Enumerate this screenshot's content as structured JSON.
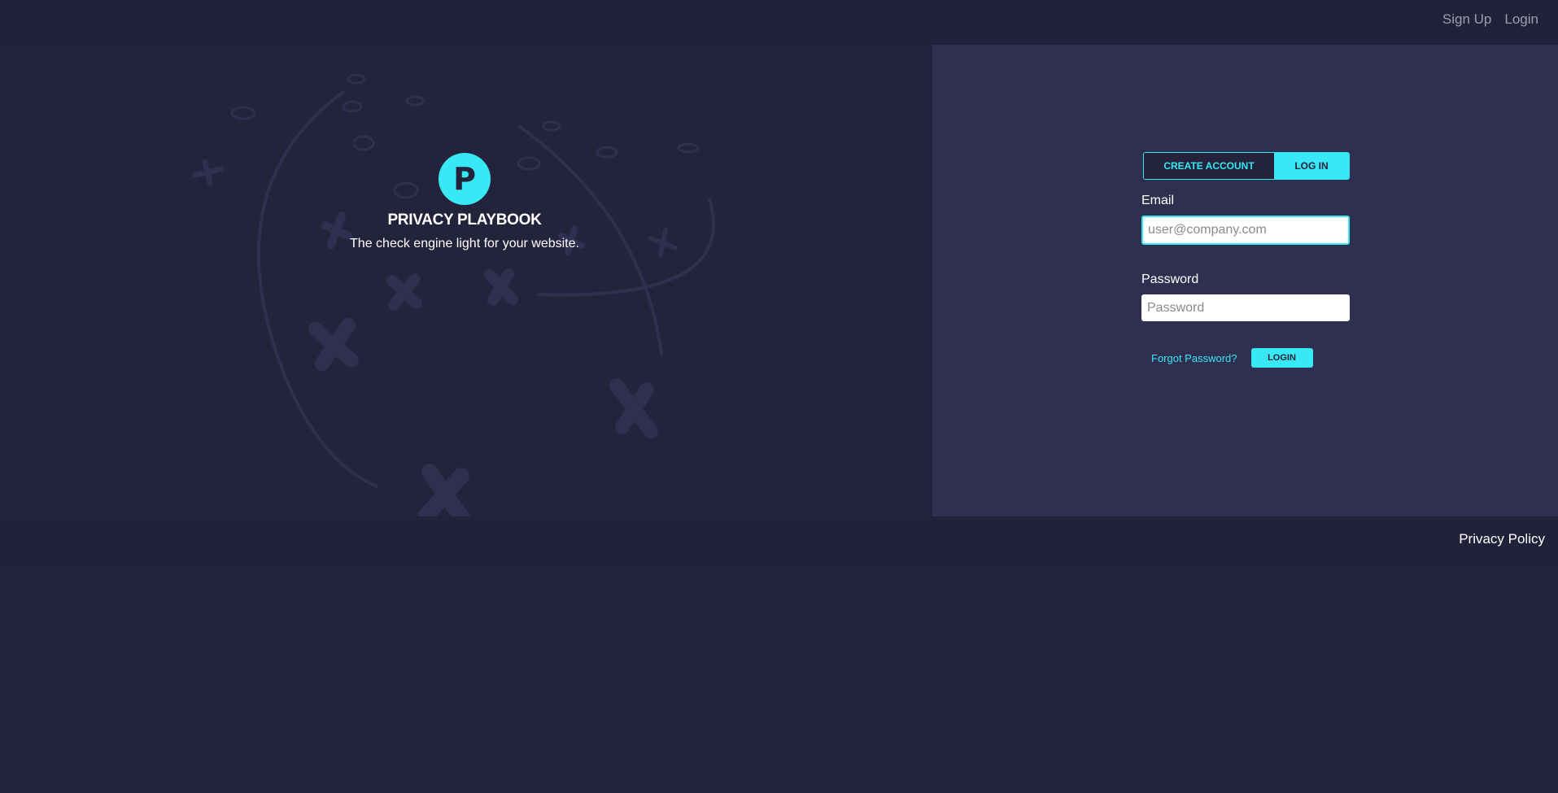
{
  "header": {
    "nav": [
      {
        "label": "Sign Up"
      },
      {
        "label": "Login"
      }
    ]
  },
  "brand": {
    "logo_letter": "P",
    "title": "PRIVACY PLAYBOOK",
    "tagline": "The check engine light for your website."
  },
  "auth": {
    "tabs": [
      {
        "label": "CREATE ACCOUNT",
        "active": false
      },
      {
        "label": "LOG IN",
        "active": true
      }
    ],
    "email": {
      "label": "Email",
      "placeholder": "user@company.com",
      "value": ""
    },
    "password": {
      "label": "Password",
      "placeholder": "Password",
      "value": ""
    },
    "forgot_label": "Forgot Password?",
    "login_button": "LOGIN"
  },
  "footer": {
    "privacy_link": "Privacy Policy"
  },
  "colors": {
    "background": "#23233c",
    "panel": "#2f2f4f",
    "accent": "#38e8f4",
    "decor": "#2f2f4f"
  }
}
